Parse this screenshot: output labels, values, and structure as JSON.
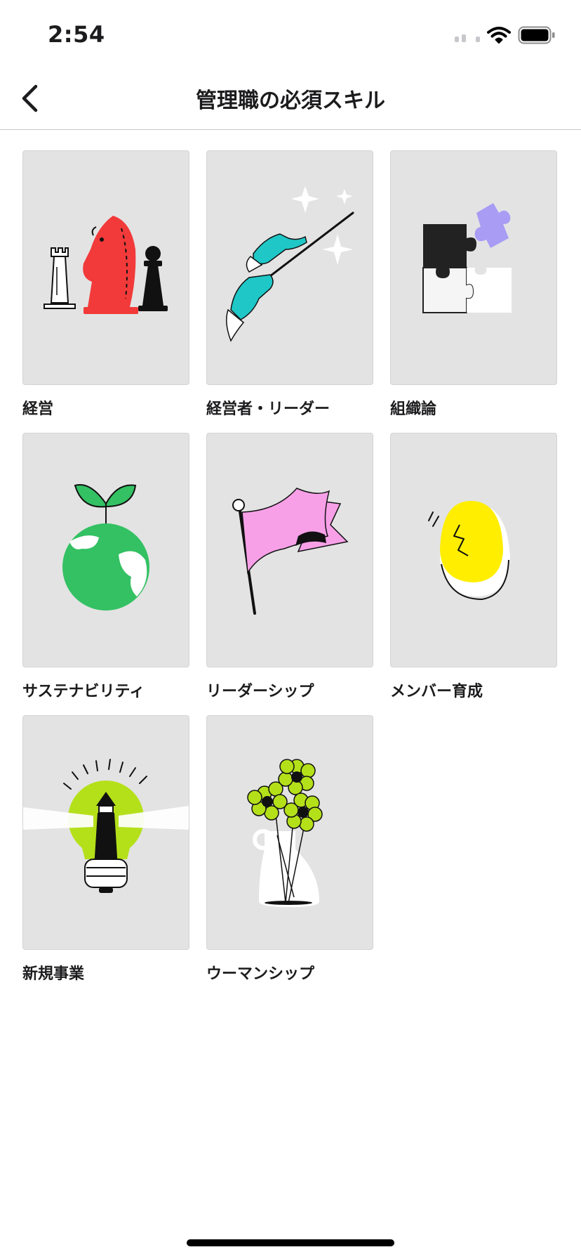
{
  "status_bar": {
    "time": "2:54"
  },
  "nav": {
    "title": "管理職の必須スキル"
  },
  "categories": [
    {
      "label": "経営",
      "icon": "chess-pieces-icon"
    },
    {
      "label": "経営者・リーダー",
      "icon": "conductor-baton-icon"
    },
    {
      "label": "組織論",
      "icon": "puzzle-pieces-icon"
    },
    {
      "label": "サステナビリティ",
      "icon": "earth-sprout-icon"
    },
    {
      "label": "リーダーシップ",
      "icon": "flag-icon"
    },
    {
      "label": "メンバー育成",
      "icon": "cracking-egg-icon"
    },
    {
      "label": "新規事業",
      "icon": "lightbulb-lighthouse-icon"
    },
    {
      "label": "ウーマンシップ",
      "icon": "flower-vase-icon"
    }
  ],
  "colors": {
    "thumbnail_bg": "#e3e3e3",
    "red": "#f23a3a",
    "teal": "#1fc7c7",
    "lavender": "#a89cf5",
    "green": "#33c163",
    "pink": "#f7a0e8",
    "yellow": "#ffee00",
    "lime": "#b4e01a"
  }
}
